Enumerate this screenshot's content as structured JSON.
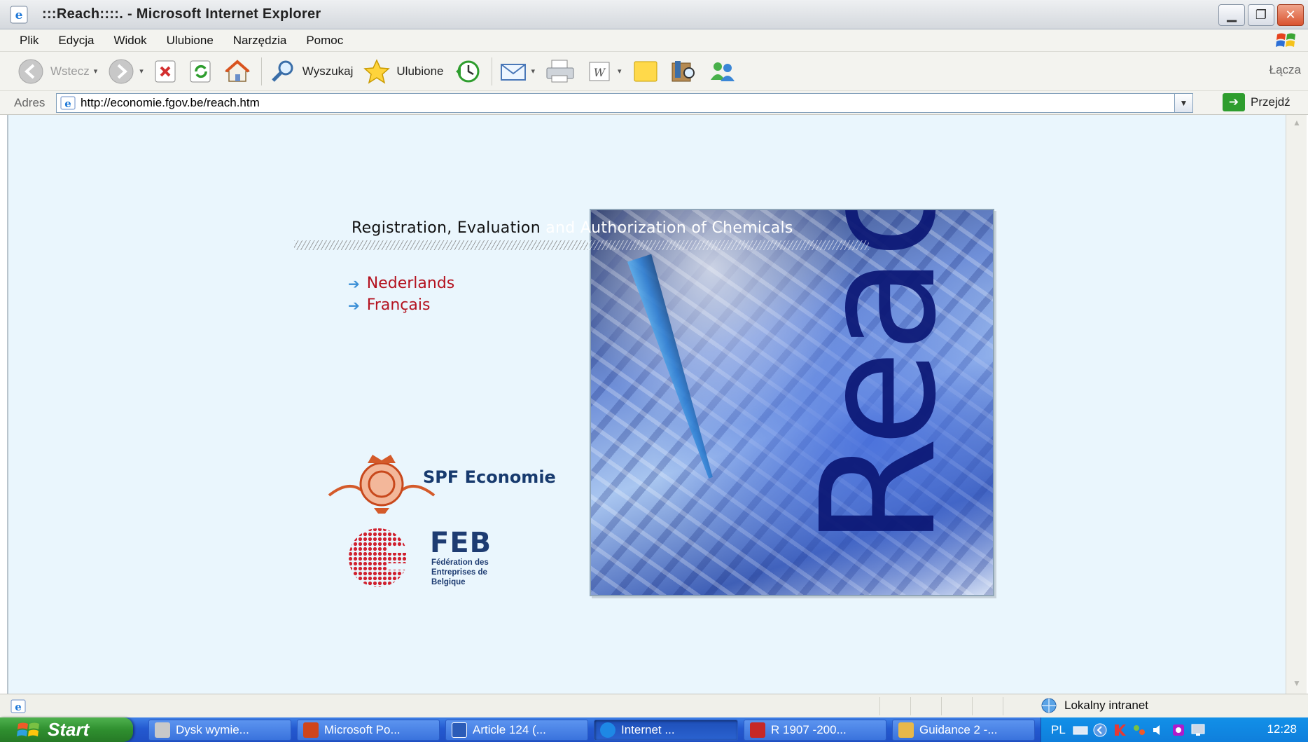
{
  "window": {
    "title": ":::Reach::::. - Microsoft Internet Explorer",
    "buttons": [
      "minimize",
      "restore",
      "close"
    ]
  },
  "menu": [
    "Plik",
    "Edycja",
    "Widok",
    "Ulubione",
    "Narzędzia",
    "Pomoc"
  ],
  "toolbar": {
    "back_label": "Wstecz",
    "search_label": "Wyszukaj",
    "favorites_label": "Ulubione",
    "links_label": "Łącza"
  },
  "address": {
    "label": "Adres",
    "url": "http://economie.fgov.be/reach.htm",
    "go_label": "Przejdź"
  },
  "page": {
    "headline_left": "Registration, Evaluation",
    "headline_right": " and Authorization of Chemicals",
    "languages": [
      "Nederlands",
      "Français"
    ],
    "cover_word": "Reach",
    "spf_logo_text": "SPF  Economie",
    "feb_logo": {
      "abbr": "FEB",
      "full": "Fédération des Entreprises de Belgique"
    }
  },
  "status": {
    "zone_label": "Lokalny intranet"
  },
  "taskbar": {
    "start_label": "Start",
    "tasks": [
      {
        "label": "Dysk wymie...",
        "icon": "drive-icon",
        "color": "#c9c9c9"
      },
      {
        "label": "Microsoft Po...",
        "icon": "powerpoint-icon",
        "color": "#d0451b"
      },
      {
        "label": "Article 124 (...",
        "icon": "word-icon",
        "color": "#2b5cb8"
      },
      {
        "label": "Internet ...",
        "icon": "ie-icon",
        "color": "#1e88e5"
      },
      {
        "label": "R 1907 -200...",
        "icon": "pdf-icon",
        "color": "#c62828"
      },
      {
        "label": "Guidance 2 -...",
        "icon": "folder-icon",
        "color": "#e8b84a"
      }
    ],
    "tray_lang": "PL",
    "clock": "12:28"
  },
  "colors": {
    "page_bg": "#eaf6fd",
    "language_link": "#b4121f",
    "logo_blue": "#173a6e",
    "cover_text": "#0b1775"
  }
}
